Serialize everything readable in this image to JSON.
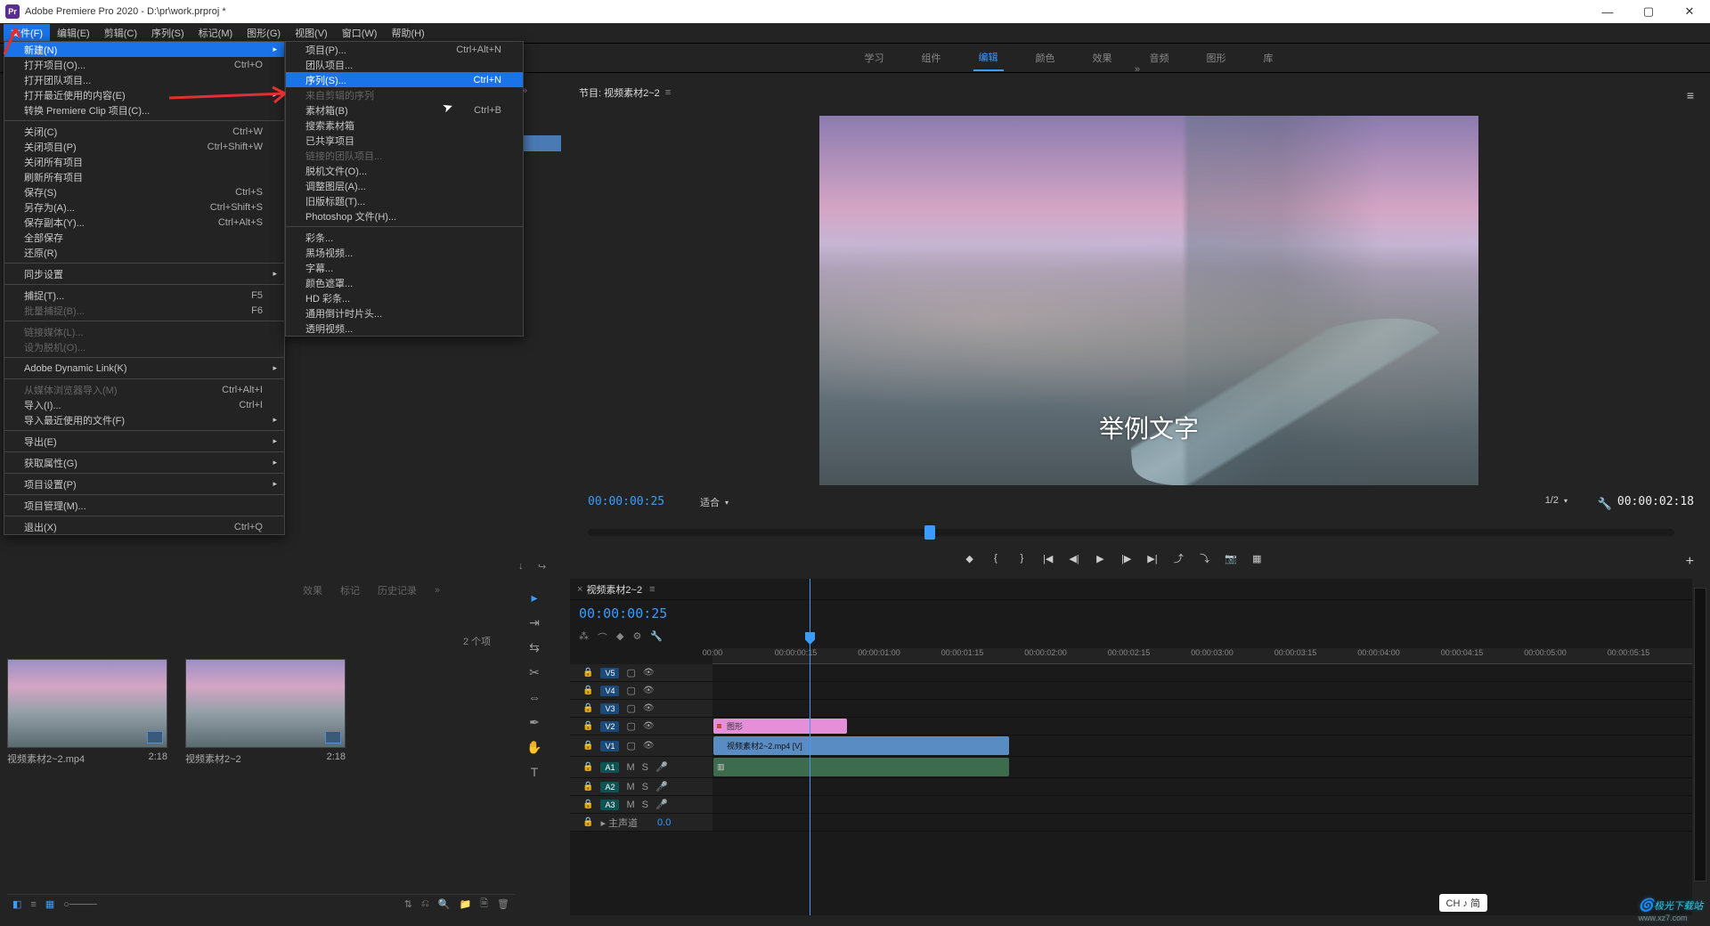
{
  "app": {
    "name": "Adobe Premiere Pro 2020",
    "doc": "D:\\pr\\work.prproj *",
    "logo": "Pr"
  },
  "menubar": [
    "文件(F)",
    "编辑(E)",
    "剪辑(C)",
    "序列(S)",
    "标记(M)",
    "图形(G)",
    "视图(V)",
    "窗口(W)",
    "帮助(H)"
  ],
  "file_menu": [
    {
      "t": "新建(N)",
      "sub": true,
      "hl": true
    },
    {
      "t": "打开项目(O)...",
      "k": "Ctrl+O"
    },
    {
      "t": "打开团队项目..."
    },
    {
      "t": "打开最近使用的内容(E)",
      "sub": true
    },
    {
      "t": "转换 Premiere Clip 项目(C)..."
    },
    {
      "sep": true
    },
    {
      "t": "关闭(C)",
      "k": "Ctrl+W"
    },
    {
      "t": "关闭项目(P)",
      "k": "Ctrl+Shift+W"
    },
    {
      "t": "关闭所有项目"
    },
    {
      "t": "刷新所有项目"
    },
    {
      "t": "保存(S)",
      "k": "Ctrl+S"
    },
    {
      "t": "另存为(A)...",
      "k": "Ctrl+Shift+S"
    },
    {
      "t": "保存副本(Y)...",
      "k": "Ctrl+Alt+S"
    },
    {
      "t": "全部保存"
    },
    {
      "t": "还原(R)"
    },
    {
      "sep": true
    },
    {
      "t": "同步设置",
      "sub": true
    },
    {
      "sep": true
    },
    {
      "t": "捕捉(T)...",
      "k": "F5"
    },
    {
      "t": "批量捕捉(B)...",
      "k": "F6",
      "dis": true
    },
    {
      "sep": true
    },
    {
      "t": "链接媒体(L)...",
      "dis": true
    },
    {
      "t": "设为脱机(O)...",
      "dis": true
    },
    {
      "sep": true
    },
    {
      "t": "Adobe Dynamic Link(K)",
      "sub": true
    },
    {
      "sep": true
    },
    {
      "t": "从媒体浏览器导入(M)",
      "k": "Ctrl+Alt+I",
      "dis": true
    },
    {
      "t": "导入(I)...",
      "k": "Ctrl+I"
    },
    {
      "t": "导入最近使用的文件(F)",
      "sub": true
    },
    {
      "sep": true
    },
    {
      "t": "导出(E)",
      "sub": true
    },
    {
      "sep": true
    },
    {
      "t": "获取属性(G)",
      "sub": true
    },
    {
      "sep": true
    },
    {
      "t": "项目设置(P)",
      "sub": true
    },
    {
      "sep": true
    },
    {
      "t": "项目管理(M)..."
    },
    {
      "sep": true
    },
    {
      "t": "退出(X)",
      "k": "Ctrl+Q"
    }
  ],
  "new_menu": [
    {
      "t": "项目(P)...",
      "k": "Ctrl+Alt+N"
    },
    {
      "t": "团队项目..."
    },
    {
      "t": "序列(S)...",
      "k": "Ctrl+N",
      "hl": true
    },
    {
      "t": "来自剪辑的序列",
      "dis": true
    },
    {
      "t": "素材箱(B)",
      "k": "Ctrl+B"
    },
    {
      "t": "搜索素材箱"
    },
    {
      "t": "已共享项目"
    },
    {
      "t": "链接的团队项目...",
      "dis": true
    },
    {
      "t": "脱机文件(O)..."
    },
    {
      "t": "调整图层(A)..."
    },
    {
      "t": "旧版标题(T)..."
    },
    {
      "t": "Photoshop 文件(H)..."
    },
    {
      "sep": true
    },
    {
      "t": "彩条..."
    },
    {
      "t": "黑场视频..."
    },
    {
      "t": "字幕..."
    },
    {
      "t": "颜色遮罩..."
    },
    {
      "t": "HD 彩条..."
    },
    {
      "t": "通用倒计时片头..."
    },
    {
      "t": "透明视频..."
    }
  ],
  "workspaces": [
    "学习",
    "组件",
    "编辑",
    "颜色",
    "效果",
    "音频",
    "图形",
    "库"
  ],
  "program": {
    "title": "节目: 视频素材2~2",
    "tc_left": "00:00:00:25",
    "tc_right": "00:00:02:18",
    "fit": "适合",
    "scale": "1/2",
    "caption": "举例文字"
  },
  "project": {
    "tabs": [
      "效果",
      "标记",
      "历史记录"
    ],
    "items_label": "2 个项",
    "thumbs": [
      {
        "name": "视频素材2~2.mp4",
        "dur": "2:18"
      },
      {
        "name": "视频素材2~2",
        "dur": "2:18"
      }
    ]
  },
  "timeline": {
    "title": "视频素材2~2",
    "tc": "00:00:00:25",
    "master": "主声道",
    "master_db": "0.0",
    "ticks": [
      "00:00",
      "00:00:00:15",
      "00:00:01:00",
      "00:00:01:15",
      "00:00:02:00",
      "00:00:02:15",
      "00:00:03:00",
      "00:00:03:15",
      "00:00:04:00",
      "00:00:04:15",
      "00:00:05:00",
      "00:00:05:15"
    ],
    "tracks_v": [
      "V5",
      "V4",
      "V3",
      "V2",
      "V1"
    ],
    "tracks_a": [
      "A1",
      "A2",
      "A3"
    ],
    "clip_gfx": "图形",
    "clip_vid": "视频素材2~2.mp4 [V]"
  },
  "ime": "CH ♪ 简",
  "watermark": {
    "a": "极光下载站",
    "b": "www.xz7.com"
  }
}
